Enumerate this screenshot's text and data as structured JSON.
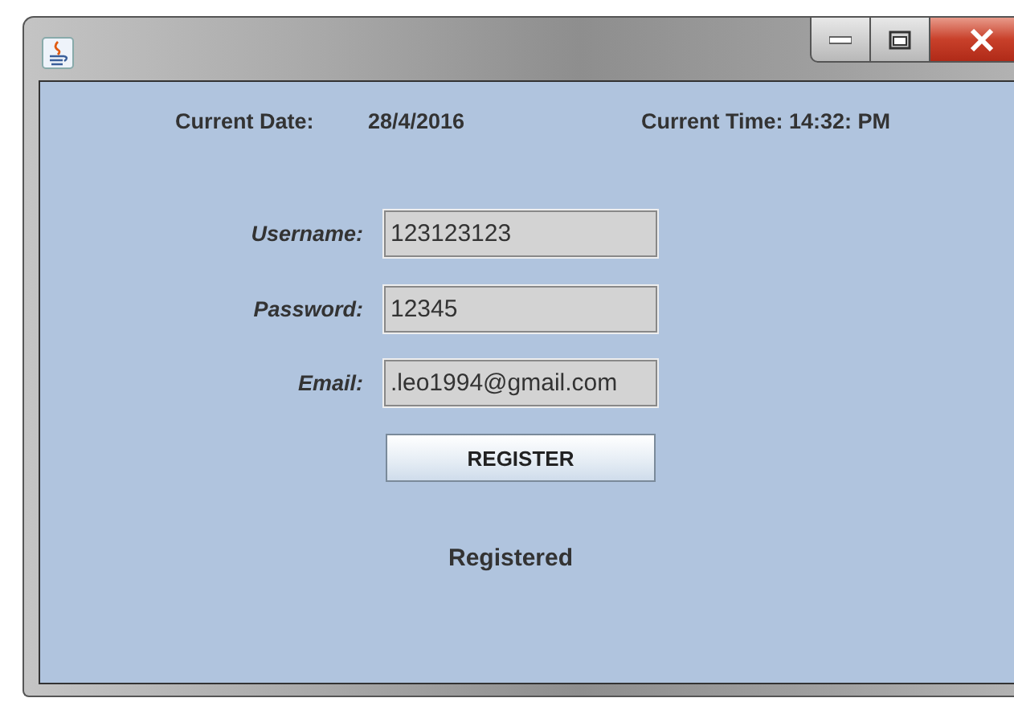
{
  "header": {
    "date_label": "Current Date:",
    "date_value": "28/4/2016",
    "time": "Current Time: 14:32: PM"
  },
  "fields": [
    {
      "label": "Username:",
      "value": "123123123"
    },
    {
      "label": "Password:",
      "value": "12345"
    },
    {
      "label": "Email:",
      "value": ".leo1994@gmail.com"
    }
  ],
  "button": {
    "label": "REGISTER"
  },
  "status": "Registered"
}
